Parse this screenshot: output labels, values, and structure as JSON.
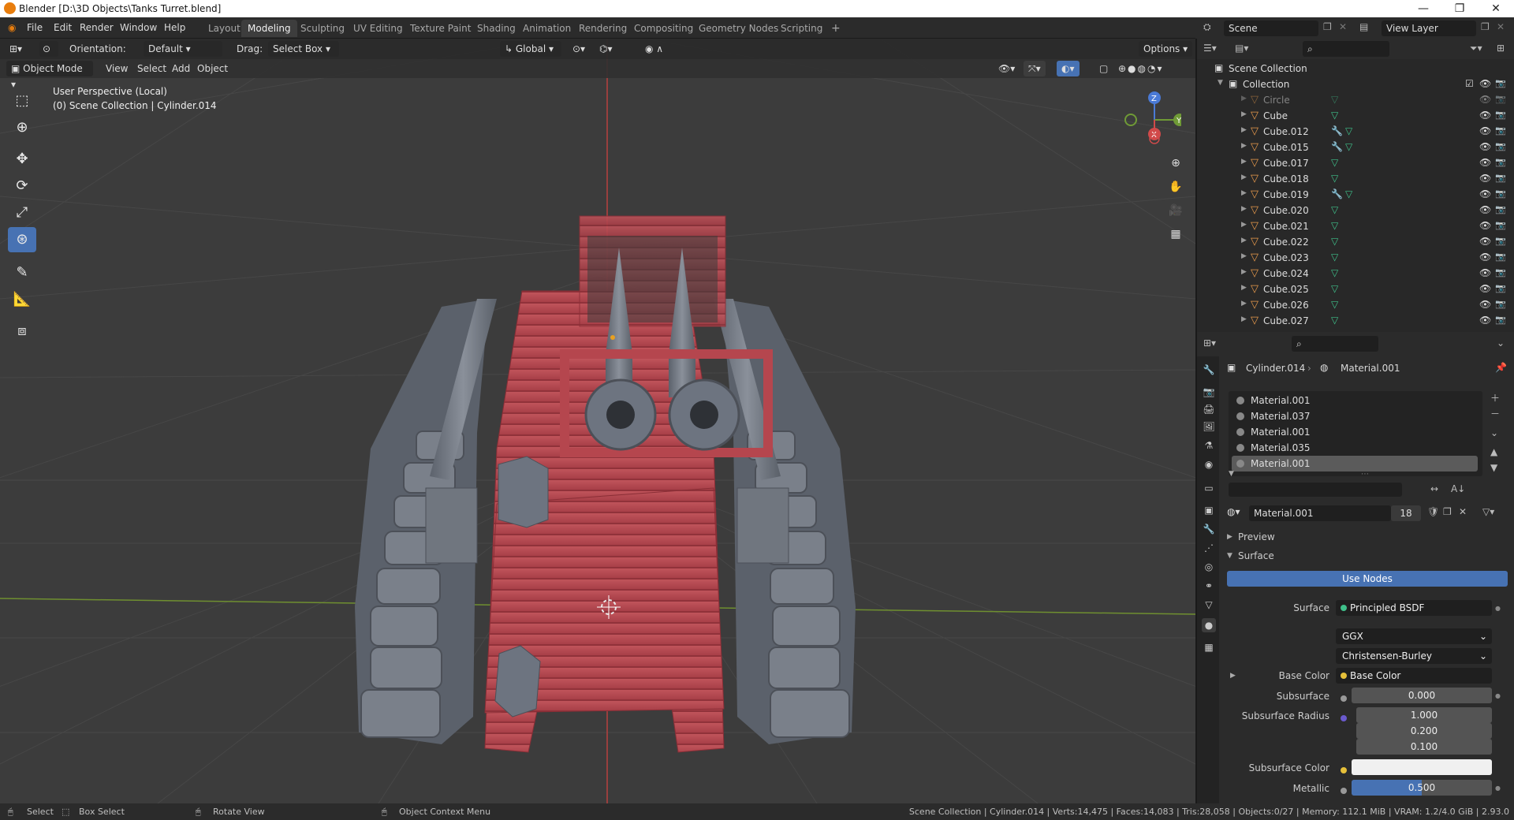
{
  "window": {
    "title": "Blender [D:\\3D Objects\\Tanks Turret.blend]",
    "minimize": "—",
    "maximize": "❐",
    "close": "✕"
  },
  "menus": [
    "File",
    "Edit",
    "Render",
    "Window",
    "Help"
  ],
  "workspace_tabs": [
    "Layout",
    "Modeling",
    "Sculpting",
    "UV Editing",
    "Texture Paint",
    "Shading",
    "Animation",
    "Rendering",
    "Compositing",
    "Geometry Nodes",
    "Scripting"
  ],
  "active_workspace": "Modeling",
  "scene": {
    "name": "Scene",
    "view_layer": "View Layer"
  },
  "viewport_header": {
    "orientation_label": "Orientation:",
    "orientation_value": "Default",
    "drag_label": "Drag:",
    "drag_value": "Select Box",
    "transform_orientation": "Global",
    "options": "Options",
    "mode": "Object Mode",
    "menus": [
      "View",
      "Select",
      "Add",
      "Object"
    ]
  },
  "viewport_overlay": {
    "perspective": "User Perspective (Local)",
    "context": "(0) Scene Collection | Cylinder.014"
  },
  "gizmo": {
    "z": "Z",
    "y": "Y",
    "x": "X"
  },
  "outliner": {
    "root": "Scene Collection",
    "collection": "Collection",
    "items": [
      {
        "name": "Circle",
        "dim": true
      },
      {
        "name": "Cube"
      },
      {
        "name": "Cube.012",
        "modifier": true
      },
      {
        "name": "Cube.015",
        "modifier": true
      },
      {
        "name": "Cube.017"
      },
      {
        "name": "Cube.018"
      },
      {
        "name": "Cube.019",
        "modifier": true
      },
      {
        "name": "Cube.020"
      },
      {
        "name": "Cube.021"
      },
      {
        "name": "Cube.022"
      },
      {
        "name": "Cube.023"
      },
      {
        "name": "Cube.024"
      },
      {
        "name": "Cube.025"
      },
      {
        "name": "Cube.026"
      },
      {
        "name": "Cube.027"
      }
    ]
  },
  "properties": {
    "object": "Cylinder.014",
    "material": "Material.001",
    "slots": [
      "Material.001",
      "Material.037",
      "Material.001",
      "Material.035",
      "Material.001"
    ],
    "selected_slot": 4,
    "material_field": "Material.001",
    "users": "18",
    "preview": "Preview",
    "surface_header": "Surface",
    "use_nodes": "Use Nodes",
    "surface_label": "Surface",
    "surface_value": "Principled BSDF",
    "distribution": "GGX",
    "subsurface_method": "Christensen-Burley",
    "base_color_label": "Base Color",
    "base_color_value": "Base Color",
    "subsurface_label": "Subsurface",
    "subsurface_value": "0.000",
    "subsurface_radius_label": "Subsurface Radius",
    "subsurface_radius": [
      "1.000",
      "0.200",
      "0.100"
    ],
    "subsurface_color_label": "Subsurface Color",
    "metallic_label": "Metallic",
    "metallic_value": "0.500",
    "metallic_fraction": 0.5
  },
  "statusbar": {
    "left": [
      "Select",
      "Box Select",
      "Rotate View",
      "Object Context Menu"
    ],
    "right": "Scene Collection | Cylinder.014 | Verts:14,475 | Faces:14,083 | Tris:28,058 | Objects:0/27 | Memory: 112.1 MiB | VRAM: 1.2/4.0 GiB | 2.93.0"
  },
  "colors": {
    "accent": "#4772b3",
    "red_axis": "#b8403f",
    "green_axis": "#6f8f30",
    "tank_wood": "#b5464e",
    "tank_metal": "#6d7480"
  }
}
